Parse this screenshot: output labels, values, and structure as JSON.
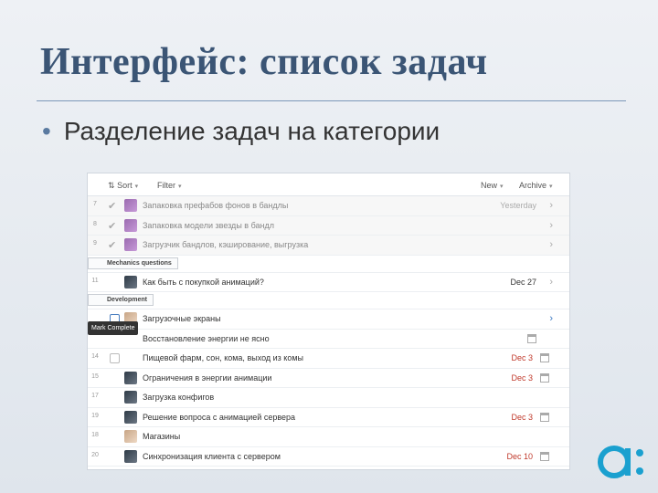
{
  "slide": {
    "title": "Интерфейс: список задач",
    "bullet": "Разделение задач на категории"
  },
  "toolbar": {
    "sort_label": "Sort",
    "filter_label": "Filter",
    "new_label": "New",
    "archive_label": "Archive"
  },
  "tooltip": "Mark Complete",
  "sections": {
    "mechanics": "Mechanics questions",
    "development": "Development"
  },
  "rows": [
    {
      "num": "7",
      "title": "Запаковка префабов фонов в бандлы",
      "date": "Yesterday",
      "done": true
    },
    {
      "num": "8",
      "title": "Запаковка модели звезды в бандл",
      "date": "",
      "done": true
    },
    {
      "num": "9",
      "title": "Загрузчик бандлов, кэширование, выгрузка",
      "date": "",
      "done": true
    },
    {
      "num": "11",
      "title": "Как быть с покупкой анимаций?",
      "date": "Dec 27",
      "done": false
    },
    {
      "num": "",
      "title": "Загрузочные экраны",
      "date": "",
      "done": false
    },
    {
      "num": "",
      "title": "Восстановление энергии не ясно",
      "date": "",
      "done": false
    },
    {
      "num": "14",
      "title": "Пищевой фарм, сон, кома, выход из комы",
      "date": "Dec 3",
      "done": false
    },
    {
      "num": "15",
      "title": "Ограничения в энергии анимации",
      "date": "Dec 3",
      "done": false
    },
    {
      "num": "17",
      "title": "Загрузка конфигов",
      "date": "",
      "done": false
    },
    {
      "num": "19",
      "title": "Решение вопроса с анимацией сервера",
      "date": "Dec 3",
      "done": false
    },
    {
      "num": "18",
      "title": "Магазины",
      "date": "",
      "done": false
    },
    {
      "num": "20",
      "title": "Синхронизация клиента с сервером",
      "date": "Dec 10",
      "done": false
    }
  ],
  "colors": {
    "title": "#3b5575",
    "overdue": "#c0392b",
    "logo": "#1aa0cf"
  }
}
